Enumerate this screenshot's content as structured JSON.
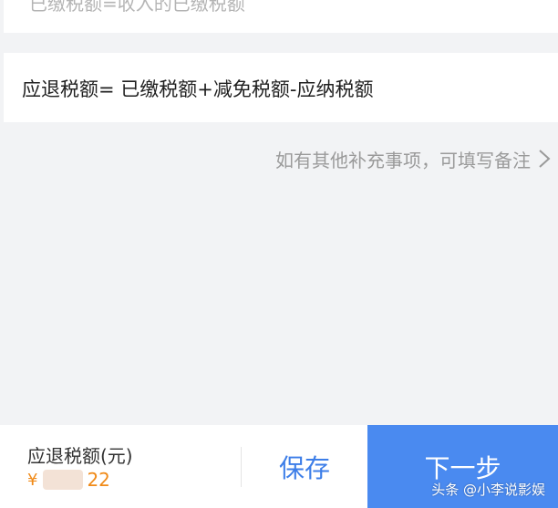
{
  "top_card": {
    "text": "已缴税额=收入的已缴税额"
  },
  "formula": {
    "text": "应退税额= 已缴税额+减免税额-应纳税额"
  },
  "remark": {
    "text": "如有其他补充事项，可填写备注",
    "icon": "chevron-right-icon"
  },
  "bottom_bar": {
    "amount_label": "应退税额(元)",
    "currency": "¥",
    "amount_suffix": "22",
    "save_label": "保存",
    "next_label": "下一步"
  },
  "watermark": {
    "text": "头条 @小李说影娱"
  },
  "colors": {
    "page_background": "#f2f3f5",
    "card_background": "#ffffff",
    "accent_blue": "#4a8af0",
    "save_text_blue": "#3d7ee8",
    "amount_orange": "#f08a18",
    "muted_text": "#9a9a9a"
  }
}
